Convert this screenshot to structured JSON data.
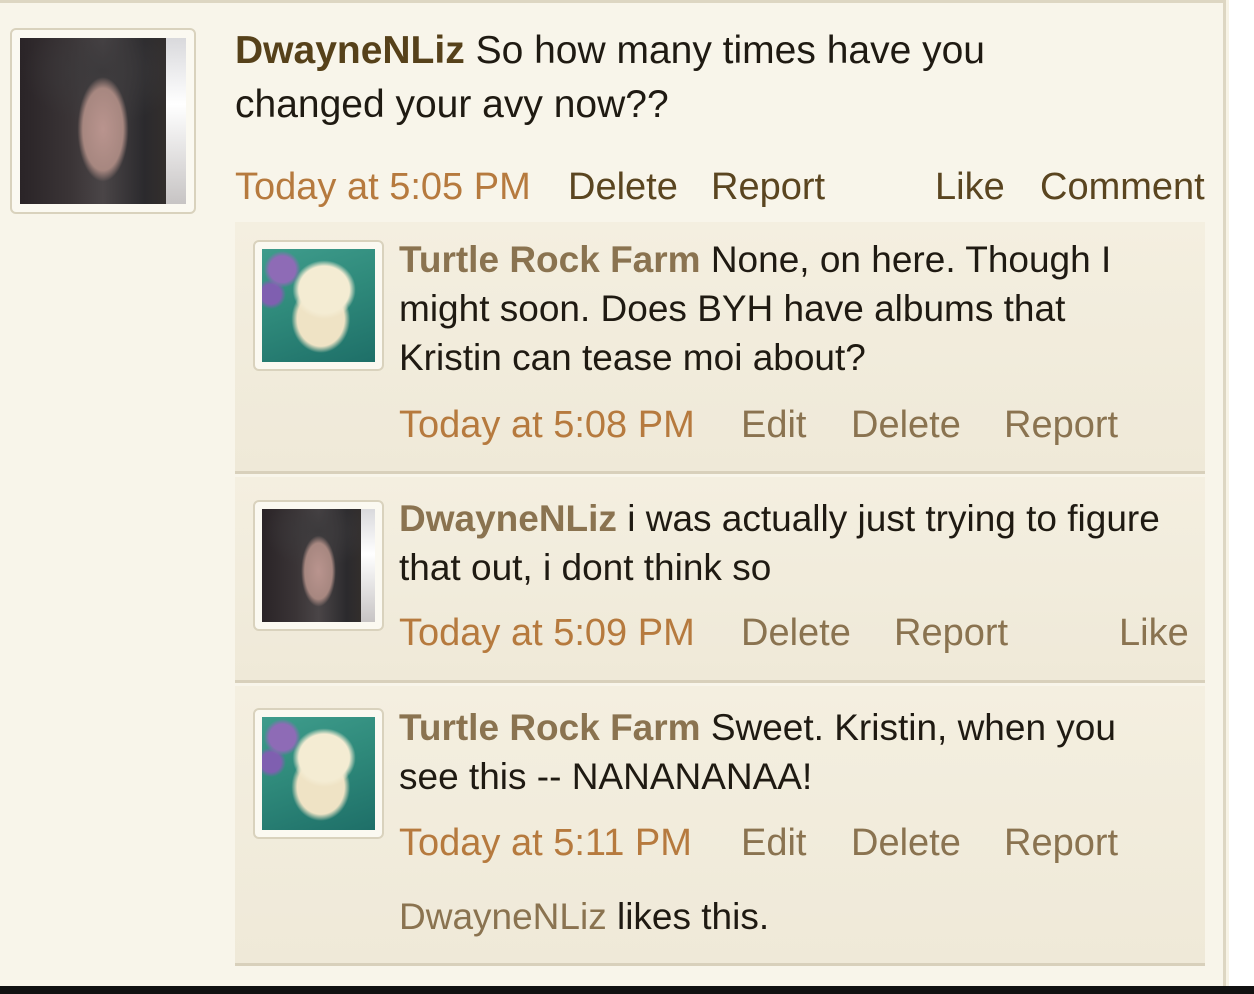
{
  "post": {
    "author": "DwayneNLiz",
    "text": "So how many times have you changed your avy now??",
    "timestamp": "Today at 5:05 PM",
    "actions": {
      "delete": "Delete",
      "report": "Report",
      "like": "Like",
      "comment": "Comment"
    }
  },
  "comments": [
    {
      "author": "Turtle Rock Farm",
      "text": "None, on here. Though I might soon. Does BYH have albums that Kristin can tease moi about?",
      "timestamp": "Today at 5:08 PM",
      "actions": {
        "edit": "Edit",
        "delete": "Delete",
        "report": "Report"
      }
    },
    {
      "author": "DwayneNLiz",
      "text": "i was actually just trying to figure that out, i dont think so",
      "timestamp": "Today at 5:09 PM",
      "actions": {
        "delete": "Delete",
        "report": "Report",
        "like": "Like"
      }
    },
    {
      "author": "Turtle Rock Farm",
      "text": "Sweet. Kristin, when you see this -- NANANANAA!",
      "timestamp": "Today at 5:11 PM",
      "actions": {
        "edit": "Edit",
        "delete": "Delete",
        "report": "Report"
      },
      "likes": {
        "name": "DwayneNLiz",
        "suffix": "likes this."
      }
    }
  ],
  "icons": {
    "avatar_horse": "horse-avatar-image",
    "avatar_chick": "chick-avatar-image"
  }
}
